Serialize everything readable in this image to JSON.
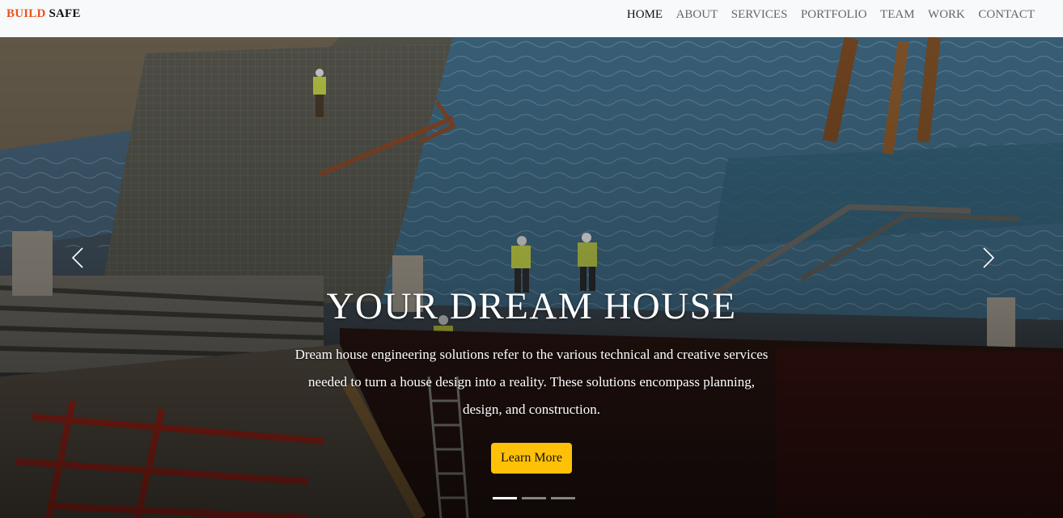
{
  "brand": {
    "part1": "BUILD",
    "part2": "SAFE",
    "accent_color": "#e8541e"
  },
  "nav": {
    "items": [
      {
        "label": "HOME",
        "active": true
      },
      {
        "label": "ABOUT",
        "active": false
      },
      {
        "label": "SERVICES",
        "active": false
      },
      {
        "label": "PORTFOLIO",
        "active": false
      },
      {
        "label": "TEAM",
        "active": false
      },
      {
        "label": "WORK",
        "active": false
      },
      {
        "label": "CONTACT",
        "active": false
      }
    ]
  },
  "hero": {
    "title": "YOUR DREAM HOUSE",
    "description": "Dream house engineering solutions refer to the various technical and creative services needed to turn a house design into a reality. These solutions encompass planning, design, and construction.",
    "cta_label": "Learn More",
    "cta_color": "#ffc107",
    "prev_icon": "chevron-left-icon",
    "next_icon": "chevron-right-icon",
    "slides_count": 3,
    "active_slide": 1
  }
}
